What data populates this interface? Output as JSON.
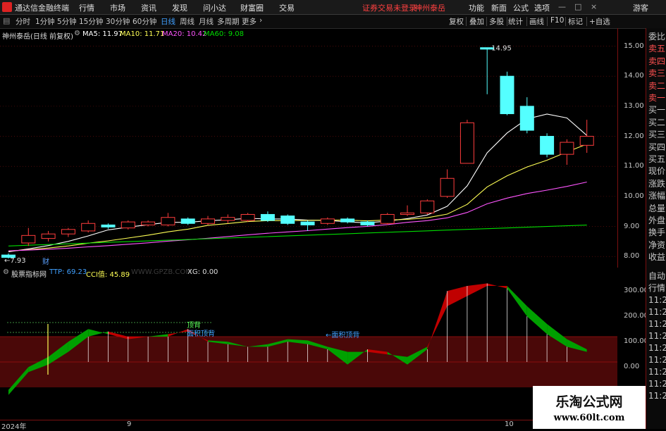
{
  "app": {
    "title": "通达信金融终端",
    "guest": "游客"
  },
  "menu": {
    "items": [
      "行情",
      "市场",
      "资讯",
      "发现",
      "问小达",
      "财富圈",
      "交易"
    ],
    "login_warning": "证券交易未登录",
    "stock_name": "神州泰岳",
    "right": [
      "功能",
      "新面",
      "公式",
      "选项"
    ]
  },
  "periods": {
    "items": [
      "分时",
      "1分钟",
      "5分钟",
      "15分钟",
      "30分钟",
      "60分钟",
      "日线",
      "周线",
      "月线",
      "多周期",
      "更多"
    ],
    "active": "日线"
  },
  "tools": {
    "items": [
      "复权",
      "叠加",
      "多股",
      "统计",
      "画线",
      "F10",
      "标记",
      "+自选"
    ]
  },
  "main_header": {
    "title": "神州泰岳(日线 前复权)",
    "ma5": "MA5: 11.97",
    "ma10": "MA10: 11.71",
    "ma20": "MA20: 10.42",
    "ma60": "MA60: 9.08"
  },
  "main_chart": {
    "high_label": "14.95",
    "low_label": "7.93",
    "fin_marker": "财",
    "y_ticks": [
      "15.00",
      "14.00",
      "13.00",
      "12.00",
      "11.00",
      "10.00",
      "9.00",
      "8.00"
    ],
    "colors": {
      "up": "#ff3c3c",
      "down": "#54ffff",
      "ma5": "#ffffff",
      "ma10": "#ffff55",
      "ma20": "#ff55ff",
      "ma60": "#00dd00",
      "grid": "#7a1010"
    }
  },
  "sub_header": {
    "title": "股票指标网",
    "ttp": "TTP: 69.23",
    "cci": "CCI值: 45.89",
    "site": "WWW.GPZB.COM",
    "xg": "XG: 0.00"
  },
  "sub_chart": {
    "labels": {
      "top_div": "顶背",
      "area_div_1": "面积顶背",
      "area_div_2": "←面积顶背"
    },
    "y_ticks": [
      "300.00",
      "200.00",
      "100.00",
      "0.00"
    ]
  },
  "right_panel": {
    "top": [
      "委比",
      "卖五",
      "卖四",
      "卖三",
      "卖二",
      "卖一",
      "买一",
      "买二",
      "买三",
      "买四",
      "买五",
      "现价",
      "涨跌",
      "涨幅",
      "总量",
      "外盘",
      "换手",
      "净资",
      "收益"
    ],
    "bottom": [
      "自动",
      "行情",
      "11:2",
      "11:2",
      "11:2",
      "11:2",
      "11:2",
      "11:2",
      "11:2",
      "11:2",
      "11:2"
    ]
  },
  "x_axis": {
    "labels": [
      "2024年",
      "9",
      "10"
    ]
  },
  "watermark": {
    "title": "乐淘公式网",
    "url": "www.60lt.com"
  },
  "chart_data": {
    "type": "candlestick",
    "y_range": [
      7.7,
      15.2
    ],
    "candles": [
      {
        "o": 8.05,
        "c": 7.97,
        "h": 8.1,
        "l": 7.93
      },
      {
        "o": 8.45,
        "c": 8.7,
        "h": 8.95,
        "l": 8.35
      },
      {
        "o": 8.6,
        "c": 8.75,
        "h": 8.85,
        "l": 8.5
      },
      {
        "o": 8.75,
        "c": 8.9,
        "h": 8.95,
        "l": 8.65
      },
      {
        "o": 8.85,
        "c": 9.1,
        "h": 9.2,
        "l": 8.8
      },
      {
        "o": 9.05,
        "c": 8.98,
        "h": 9.1,
        "l": 8.92
      },
      {
        "o": 8.95,
        "c": 9.15,
        "h": 9.2,
        "l": 8.9
      },
      {
        "o": 9.05,
        "c": 9.15,
        "h": 9.2,
        "l": 9.0
      },
      {
        "o": 9.05,
        "c": 9.3,
        "h": 9.45,
        "l": 9.0
      },
      {
        "o": 9.25,
        "c": 9.1,
        "h": 9.3,
        "l": 9.05
      },
      {
        "o": 9.1,
        "c": 9.25,
        "h": 9.35,
        "l": 9.05
      },
      {
        "o": 9.2,
        "c": 9.3,
        "h": 9.4,
        "l": 9.1
      },
      {
        "o": 9.2,
        "c": 9.4,
        "h": 9.45,
        "l": 9.15
      },
      {
        "o": 9.4,
        "c": 9.2,
        "h": 9.5,
        "l": 9.15
      },
      {
        "o": 9.35,
        "c": 9.1,
        "h": 9.4,
        "l": 9.05
      },
      {
        "o": 9.15,
        "c": 9.05,
        "h": 9.2,
        "l": 8.85
      },
      {
        "o": 9.1,
        "c": 9.25,
        "h": 9.3,
        "l": 9.05
      },
      {
        "o": 9.25,
        "c": 9.15,
        "h": 9.3,
        "l": 9.1
      },
      {
        "o": 9.15,
        "c": 9.05,
        "h": 9.2,
        "l": 9.0
      },
      {
        "o": 9.1,
        "c": 9.4,
        "h": 9.45,
        "l": 9.05
      },
      {
        "o": 9.4,
        "c": 9.45,
        "h": 9.7,
        "l": 9.35
      },
      {
        "o": 9.45,
        "c": 9.85,
        "h": 9.9,
        "l": 9.4
      },
      {
        "o": 10.0,
        "c": 10.6,
        "h": 10.9,
        "l": 9.95
      },
      {
        "o": 11.1,
        "c": 12.45,
        "h": 12.55,
        "l": 11.1
      },
      {
        "o": 14.95,
        "c": 14.9,
        "h": 14.95,
        "l": 13.4
      },
      {
        "o": 14.0,
        "c": 12.75,
        "h": 14.15,
        "l": 12.7
      },
      {
        "o": 13.0,
        "c": 12.2,
        "h": 13.3,
        "l": 12.1
      },
      {
        "o": 12.0,
        "c": 11.4,
        "h": 12.1,
        "l": 11.3
      },
      {
        "o": 11.4,
        "c": 11.8,
        "h": 11.9,
        "l": 11.05
      },
      {
        "o": 11.7,
        "c": 12.0,
        "h": 12.55,
        "l": 11.45
      }
    ]
  }
}
